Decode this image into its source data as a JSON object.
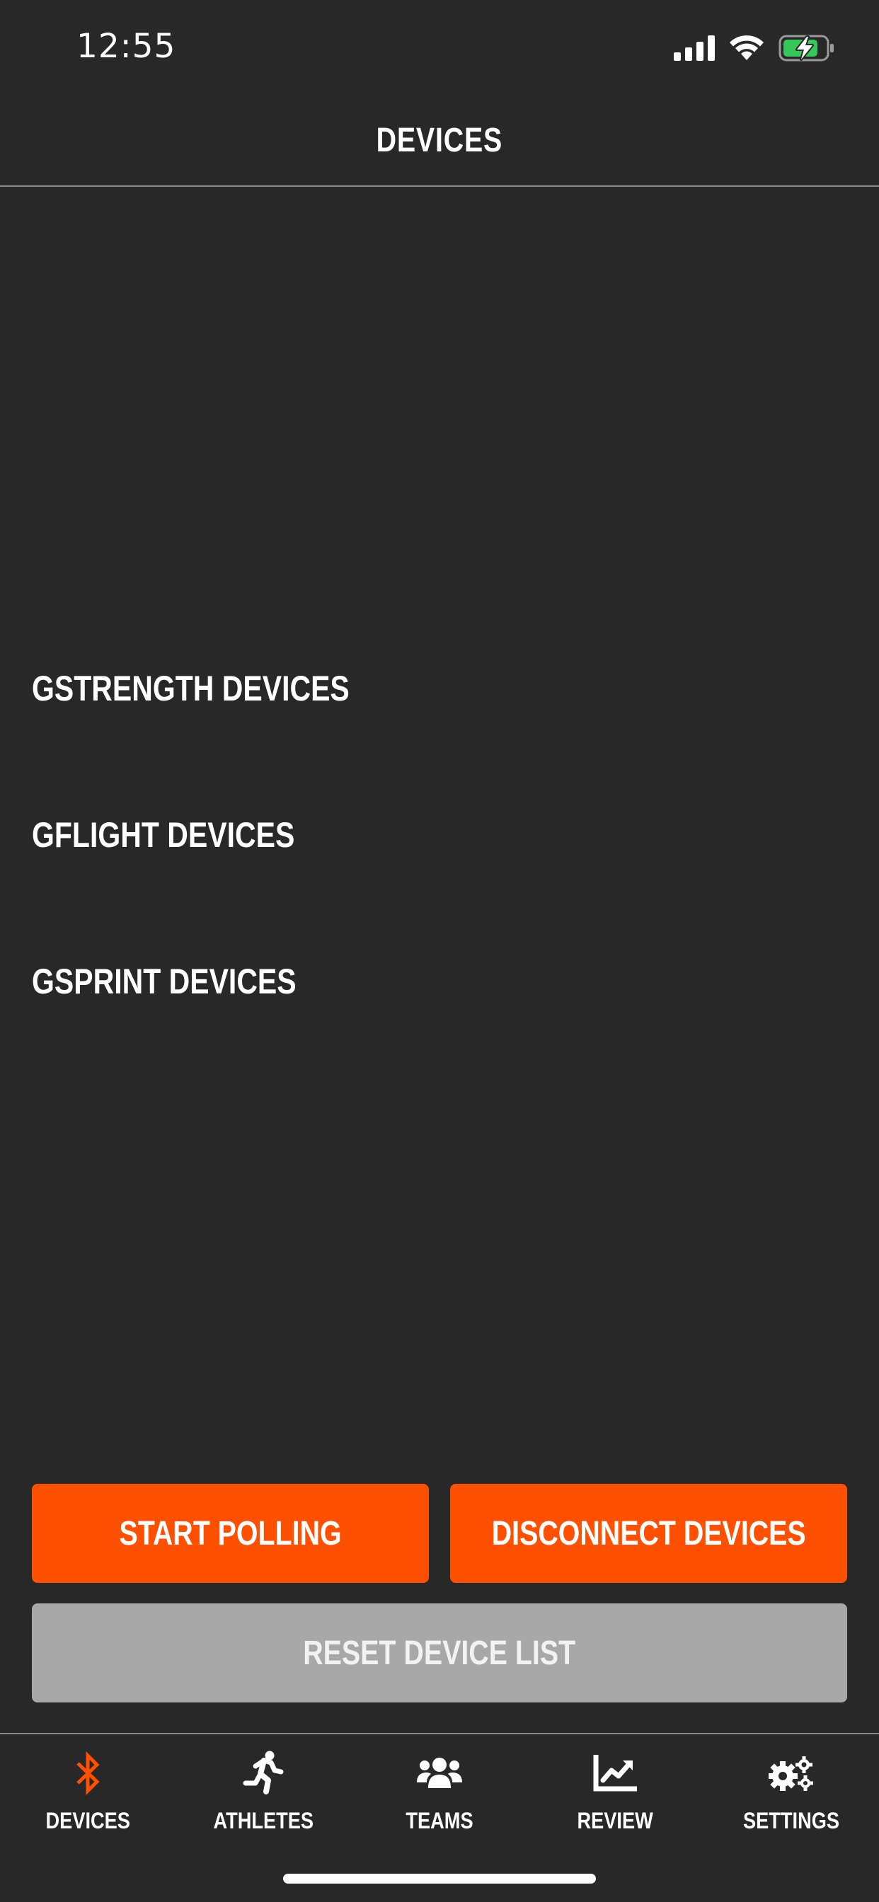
{
  "status_bar": {
    "time": "12:55"
  },
  "header": {
    "title": "DEVICES"
  },
  "sections": [
    {
      "label": "GSTRENGTH DEVICES"
    },
    {
      "label": "GFLIGHT DEVICES"
    },
    {
      "label": "GSPRINT DEVICES"
    }
  ],
  "actions": {
    "start_polling": "START POLLING",
    "disconnect_devices": "DISCONNECT DEVICES",
    "reset_device_list": "RESET DEVICE LIST"
  },
  "tabs": [
    {
      "label": "DEVICES",
      "icon": "bluetooth-icon",
      "active": true
    },
    {
      "label": "ATHLETES",
      "icon": "running-person-icon",
      "active": false
    },
    {
      "label": "TEAMS",
      "icon": "users-icon",
      "active": false
    },
    {
      "label": "REVIEW",
      "icon": "chart-line-icon",
      "active": false
    },
    {
      "label": "SETTINGS",
      "icon": "gears-icon",
      "active": false
    }
  ],
  "colors": {
    "background": "#282828",
    "accent": "#ff4f00",
    "secondary_button": "#a8a8a8",
    "battery_charging": "#34c759"
  }
}
